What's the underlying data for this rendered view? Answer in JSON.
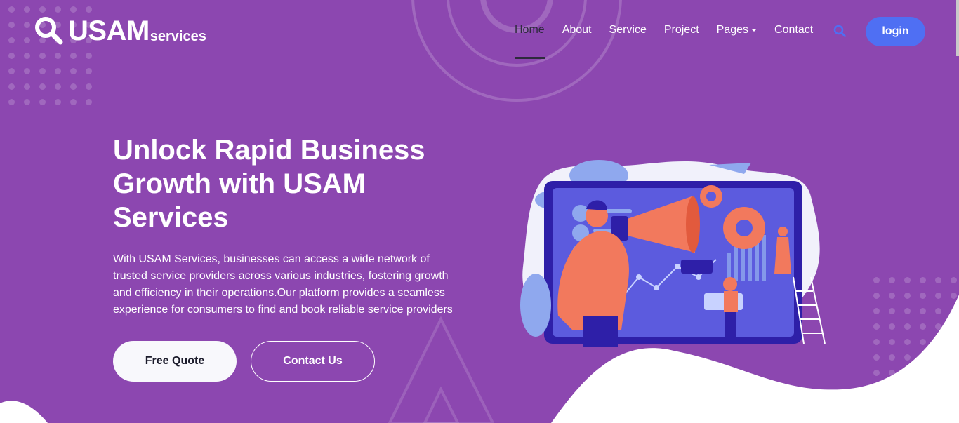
{
  "brand": {
    "name": "USAM",
    "suffix": "services"
  },
  "nav": {
    "items": [
      {
        "label": "Home",
        "active": true
      },
      {
        "label": "About"
      },
      {
        "label": "Service"
      },
      {
        "label": "Project"
      },
      {
        "label": "Pages",
        "dropdown": true
      },
      {
        "label": "Contact"
      }
    ],
    "login_label": "login"
  },
  "hero": {
    "title": "Unlock Rapid Business Growth with USAM Services",
    "description": "With USAM Services, businesses can access a wide network of trusted service providers across various industries, fostering growth and efficiency in their operations.Our platform provides a seamless experience for consumers to find and book reliable service providers",
    "primary_button": "Free Quote",
    "secondary_button": "Contact Us"
  },
  "colors": {
    "background": "#8c47b0",
    "accent": "#4f6ff3",
    "illustration_primary": "#f2795d",
    "illustration_secondary": "#3a2bb0"
  },
  "icons": [
    "search-icon",
    "caret-down-icon",
    "logo-magnifier-icon"
  ]
}
